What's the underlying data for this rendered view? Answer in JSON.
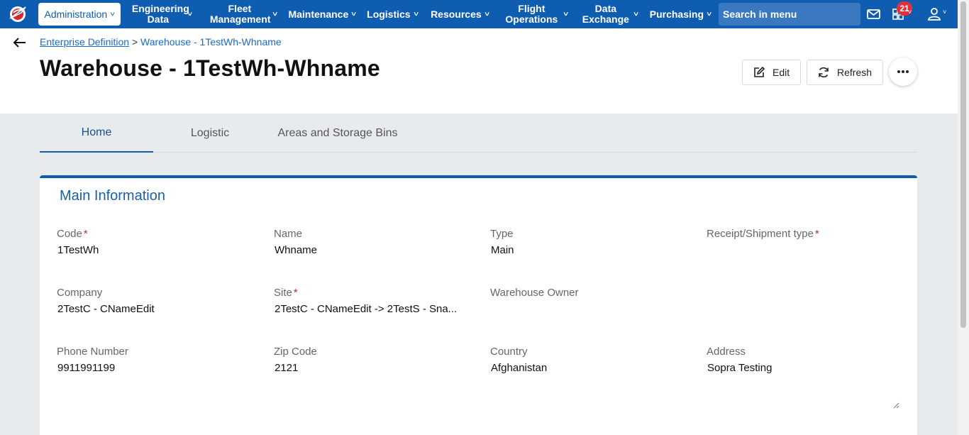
{
  "nav": {
    "items": [
      {
        "label": "Administration",
        "active": true
      },
      {
        "label": "Engineering Data"
      },
      {
        "label": "Fleet Management"
      },
      {
        "label": "Maintenance"
      },
      {
        "label": "Logistics"
      },
      {
        "label": "Resources"
      },
      {
        "label": "Flight Operations"
      },
      {
        "label": "Data Exchange"
      },
      {
        "label": "Purchasing"
      }
    ],
    "search_placeholder": "Search in menu",
    "notifications_count": "21"
  },
  "breadcrumb": {
    "parent": "Enterprise Definition",
    "separator": ">",
    "current": "Warehouse - 1TestWh-Whname"
  },
  "page": {
    "title": "Warehouse - 1TestWh-Whname",
    "edit_label": "Edit",
    "refresh_label": "Refresh"
  },
  "tabs": [
    {
      "label": "Home",
      "active": true
    },
    {
      "label": "Logistic"
    },
    {
      "label": "Areas and Storage Bins"
    }
  ],
  "main_info": {
    "title": "Main Information",
    "fields": [
      {
        "label": "Code",
        "required": true,
        "value": "1TestWh"
      },
      {
        "label": "Name",
        "required": false,
        "value": "Whname"
      },
      {
        "label": "Type",
        "required": false,
        "value": "Main"
      },
      {
        "label": "Receipt/Shipment type",
        "required": true,
        "value": ""
      },
      {
        "label": "Company",
        "required": false,
        "value": "2TestC - CNameEdit"
      },
      {
        "label": "Site",
        "required": true,
        "value": "2TestC - CNameEdit -> 2TestS - Sna..."
      },
      {
        "label": "Warehouse Owner",
        "required": false,
        "value": ""
      },
      {
        "label": "Phone Number",
        "required": false,
        "value": "9911991199"
      },
      {
        "label": "Zip Code",
        "required": false,
        "value": "2121"
      },
      {
        "label": "Country",
        "required": false,
        "value": "Afghanistan"
      },
      {
        "label": "Address",
        "required": false,
        "value": "Sopra Testing"
      }
    ],
    "required_marker": "*"
  },
  "colors": {
    "nav_bg": "#0f5db1",
    "accent": "#1b5fa8",
    "badge": "#e0313b",
    "required": "#b23030"
  }
}
